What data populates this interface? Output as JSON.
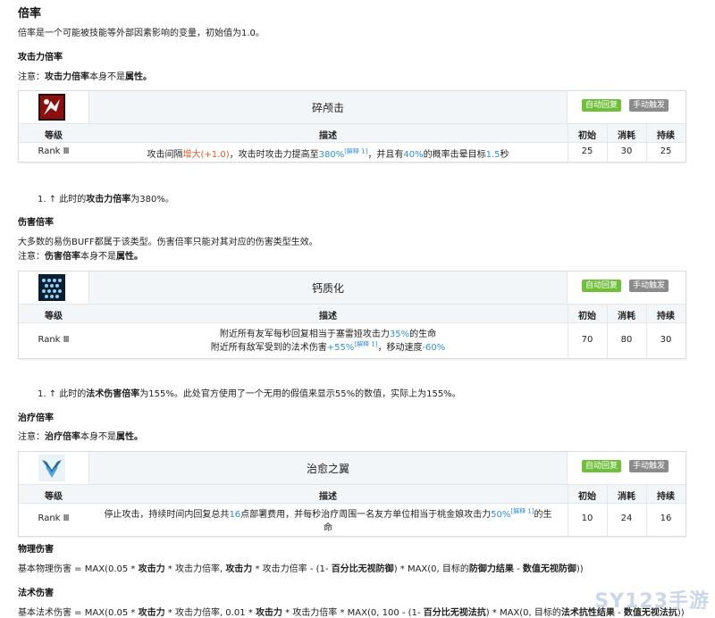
{
  "section": {
    "title": "倍率",
    "intro": "倍率是一个可能被技能等外部因素影响的变量，初始值为1.0。"
  },
  "atk": {
    "heading": "攻击力倍率",
    "note_prefix": "注意：",
    "note_bold": "攻击力倍率",
    "note_mid": "本身不是",
    "note_end": "属性。",
    "skill": {
      "icon": "shatter-strike-icon",
      "name": "碎颅击",
      "tag_auto": "自动回复",
      "tag_manual": "手动触发",
      "col_level": "等级",
      "col_desc": "描述",
      "col_init": "初始",
      "col_cost": "消耗",
      "col_dur": "持续",
      "level": "Rank Ⅲ",
      "d1": "攻击间隔",
      "d2": "增大(+1.0)",
      "d3": "，攻击时攻击力提高至",
      "d4": "380%",
      "d5": "[解释 1]",
      "d6": "，并且有",
      "d7": "40%",
      "d8": "的概率击晕目标",
      "d9": "1.5",
      "d10": "秒",
      "init": "25",
      "cost": "30",
      "dur": "25"
    },
    "footnote_pre": "1. ↑ 此时的",
    "footnote_bold": "攻击力倍率",
    "footnote_post": "为380%。"
  },
  "dmg": {
    "heading": "伤害倍率",
    "desc": "大多数的易伤BUFF都属于该类型。伤害倍率只能对其对应的伤害类型生效。",
    "note_prefix": "注意：",
    "note_bold": "伤害倍率",
    "note_mid": "本身不是",
    "note_end": "属性。",
    "skill": {
      "icon": "calcification-icon",
      "name": "钙质化",
      "tag_auto": "自动回复",
      "tag_manual": "手动触发",
      "col_level": "等级",
      "col_desc": "描述",
      "col_init": "初始",
      "col_cost": "消耗",
      "col_dur": "持续",
      "level": "Rank Ⅲ",
      "l1a": "附近所有友军每秒回复相当于塞雷娅攻击力",
      "l1b": "35%",
      "l1c": "的生命",
      "l2a": "附近所有敌军受到的法术伤害",
      "l2b": "+55%",
      "l2c": "[解释 1]",
      "l2d": "，移动速度",
      "l2e": "-60%",
      "init": "70",
      "cost": "80",
      "dur": "30"
    },
    "footnote_pre": "1. ↑ 此时的",
    "footnote_bold": "法术伤害倍率",
    "footnote_post": "为155%。此处官方使用了一个无用的假值来显示55%的数值，实际上为155%。"
  },
  "heal": {
    "heading": "治疗倍率",
    "note_prefix": "注意：",
    "note_bold": "治疗倍率",
    "note_mid": "本身不是",
    "note_end": "属性。",
    "skill": {
      "icon": "healing-wings-icon",
      "name": "治愈之翼",
      "tag_auto": "自动回复",
      "tag_manual": "手动触发",
      "col_level": "等级",
      "col_desc": "描述",
      "col_init": "初始",
      "col_cost": "消耗",
      "col_dur": "持续",
      "level": "Rank Ⅲ",
      "l1a": "停止攻击，持续时间内回复总共",
      "l1b": "16",
      "l1c": "点部署费用，并每秒治疗周围一名友方单位相当于桃金娘攻击力",
      "l1d": "50%",
      "l1e": "[解释 1]",
      "l1f": "的生",
      "l2": "命",
      "init": "10",
      "cost": "24",
      "dur": "16"
    }
  },
  "phys": {
    "heading": "物理伤害",
    "f1": "基本物理伤害 = MAX(0.05 * ",
    "f2": "攻击力",
    "f3": " * 攻击力倍率, ",
    "f4": "攻击力",
    "f5": " * 攻击力倍率 - (1- ",
    "f6": "百分比无视防御",
    "f7": ") * MAX(0, 目标的",
    "f8": "防御力结果",
    "f9": " - ",
    "f10": "数值无视防御",
    "f11": "))"
  },
  "magic": {
    "heading": "法术伤害",
    "f1": "基本法术伤害 = MAX(0.05 * ",
    "f2": "攻击力",
    "f3": " * 攻击力倍率, 0.01 * ",
    "f4": "攻击力",
    "f5": " * 攻击力倍率 * MAX(0, 100 - (1- ",
    "f6": "百分比无视法抗",
    "f7": ") * MAX(0, 目标的",
    "f8": "法术抗性结果",
    "f9": " - ",
    "f10": "数值无视法抗",
    "f11": "))"
  },
  "watermark": "SY123手游"
}
